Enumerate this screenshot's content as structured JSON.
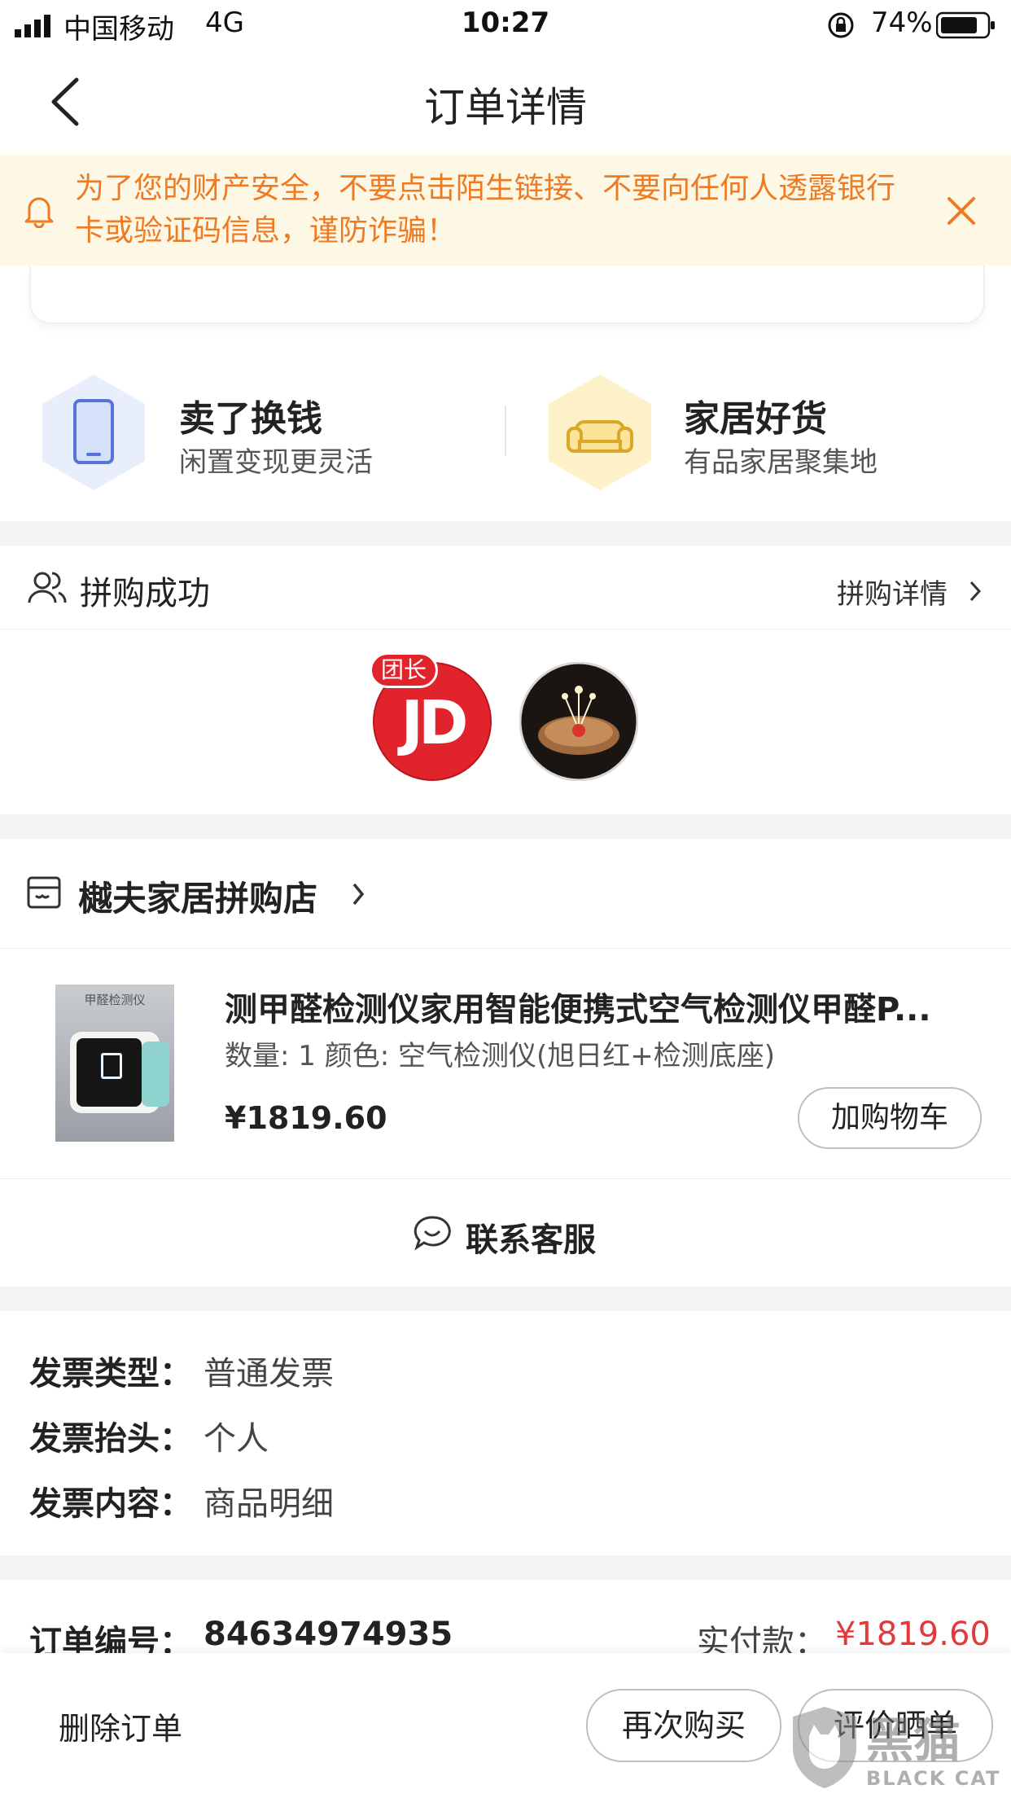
{
  "status_bar": {
    "carrier": "中国移动",
    "network": "4G",
    "time": "10:27",
    "battery": "74%"
  },
  "nav": {
    "title": "订单详情"
  },
  "notice": {
    "text": "为了您的财产安全，不要点击陌生链接、不要向任何人透露银行卡或验证码信息，谨防诈骗！"
  },
  "promos": [
    {
      "title": "卖了换钱",
      "subtitle": "闲置变现更灵活"
    },
    {
      "title": "家居好货",
      "subtitle": "有品家居聚集地"
    }
  ],
  "group": {
    "title": "拼购成功",
    "detail_link": "拼购详情",
    "leader_badge": "团长",
    "leader_logo": "JD"
  },
  "shop": {
    "name": "樾夫家居拼购店"
  },
  "product": {
    "image_caption": "甲醛检测仪",
    "title": "测甲醛检测仪家用智能便携式空气检测仪甲醛P...",
    "specs": "数量: 1 颜色: 空气检测仪(旭日红+检测底座)",
    "price": "¥1819.60",
    "add_cart_label": "加购物车"
  },
  "service": {
    "label": "联系客服"
  },
  "invoice": {
    "type_label": "发票类型：",
    "type_value": "普通发票",
    "head_label": "发票抬头：",
    "head_value": "个人",
    "content_label": "发票内容：",
    "content_value": "商品明细"
  },
  "order": {
    "number_label": "订单编号：",
    "number_value": "84634974935",
    "paid_label": "实付款：",
    "paid_value": "¥1819.60"
  },
  "bottom_bar": {
    "delete_label": "删除订单",
    "rebuy_label": "再次购买",
    "review_label": "评价晒单"
  },
  "watermark": {
    "brand": "黑猫",
    "brand_en": "BLACK CAT"
  },
  "colors": {
    "accent": "#e4393c",
    "notice_text": "#ee7a22",
    "notice_bg": "#fdf7e6"
  }
}
